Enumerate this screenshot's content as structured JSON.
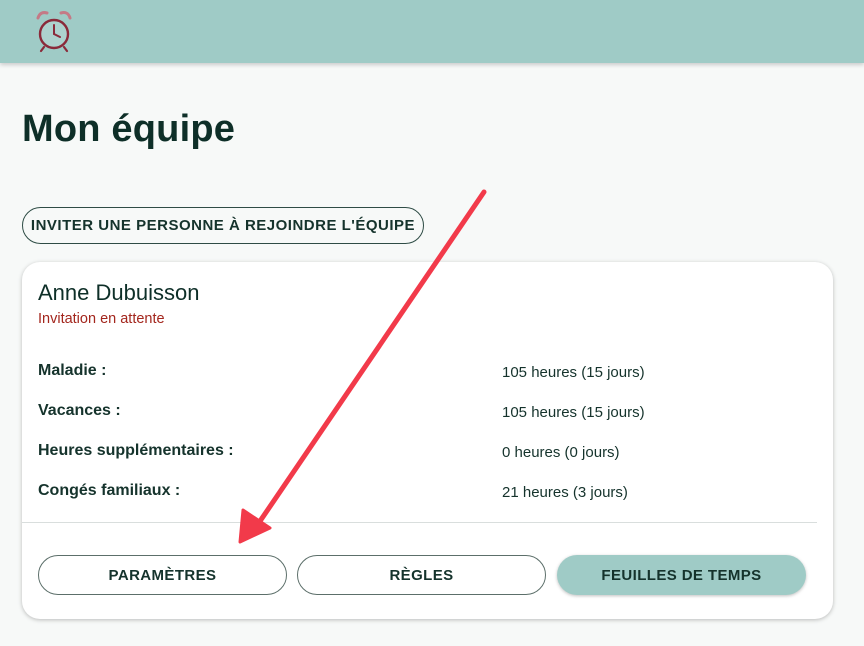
{
  "header": {
    "logo_icon": "alarm-clock-icon"
  },
  "page": {
    "title": "Mon équipe"
  },
  "actions": {
    "invite_label": "INVITER UNE PERSONNE À REJOINDRE L'ÉQUIPE"
  },
  "member": {
    "name": "Anne Dubuisson",
    "status": "Invitation en attente",
    "balances": [
      {
        "label": "Maladie :",
        "value": "105 heures (15 jours)"
      },
      {
        "label": "Vacances :",
        "value": "105 heures (15 jours)"
      },
      {
        "label": "Heures supplémentaires :",
        "value": "0 heures (0 jours)"
      },
      {
        "label": "Congés familiaux :",
        "value": "21 heures (3 jours)"
      }
    ],
    "buttons": {
      "settings": "PARAMÈTRES",
      "rules": "RÈGLES",
      "timesheets": "FEUILLES DE TEMPS"
    }
  },
  "colors": {
    "header_bg": "#9fcbc6",
    "status_red": "#a3261d",
    "annotation_arrow": "#f23a4a"
  }
}
